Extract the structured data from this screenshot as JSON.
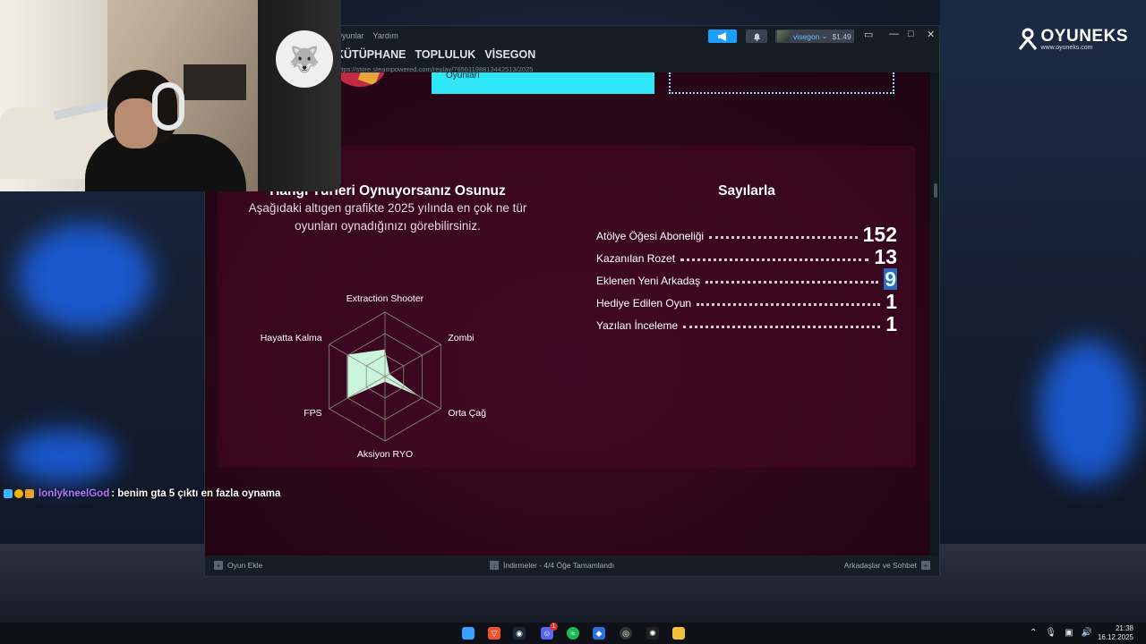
{
  "brand": {
    "name": "OYUNEKS",
    "url": "www.oyuneks.com"
  },
  "steam": {
    "menu": [
      "Oyunlar",
      "Yardım"
    ],
    "user": {
      "name": "visegon",
      "balance": "$1.49"
    },
    "nav_tabs": [
      "KÜTÜPHANE",
      "TOPLULUK",
      "VİSEGON"
    ],
    "url": "https://store.steampowered.com/replay/76561198813442513/2025",
    "cyan_box_text": "Oyunları"
  },
  "genres": {
    "title": "Hangi Türleri Oynuyorsanız Osunuz",
    "description": "Aşağıdaki altıgen grafikte 2025 yılında en çok ne tür oyunları oynadığınızı görebilirsiniz.",
    "chart_data": {
      "type": "radar",
      "axes": [
        "Extraction Shooter",
        "Zombi",
        "Orta Çağ",
        "Aksiyon RYO",
        "FPS",
        "Hayatta Kalma"
      ],
      "values": [
        0.42,
        0.08,
        0.62,
        0.08,
        0.68,
        0.68
      ],
      "ylim": [
        0,
        1
      ],
      "fill_color": "#c9f5db"
    }
  },
  "stats": {
    "title": "Sayılarla",
    "rows": [
      {
        "label": "Atölye Öğesi Aboneliği",
        "value": "152"
      },
      {
        "label": "Kazanılan Rozet",
        "value": "13"
      },
      {
        "label": "Eklenen Yeni Arkadaş",
        "value": "9"
      },
      {
        "label": "Hediye Edilen Oyun",
        "value": "1"
      },
      {
        "label": "Yazılan İnceleme",
        "value": "1"
      }
    ]
  },
  "bottom_bar": {
    "add_game": "Oyun Ekle",
    "downloads": "İndirmeler - 4/4 Öğe Tamamlandı",
    "friends": "Arkadaşlar ve Sohbet"
  },
  "chat": {
    "user": "lonlykneelGod",
    "message": ": benim gta 5 çıktı en fazla oynama"
  },
  "taskbar": {
    "time": "21:38",
    "date": "16.12.2025",
    "discord_badge": "1"
  },
  "colors": {
    "accent": "#1a9fff",
    "chat_user": "#b377ff",
    "page_bg": "#2c0619"
  }
}
